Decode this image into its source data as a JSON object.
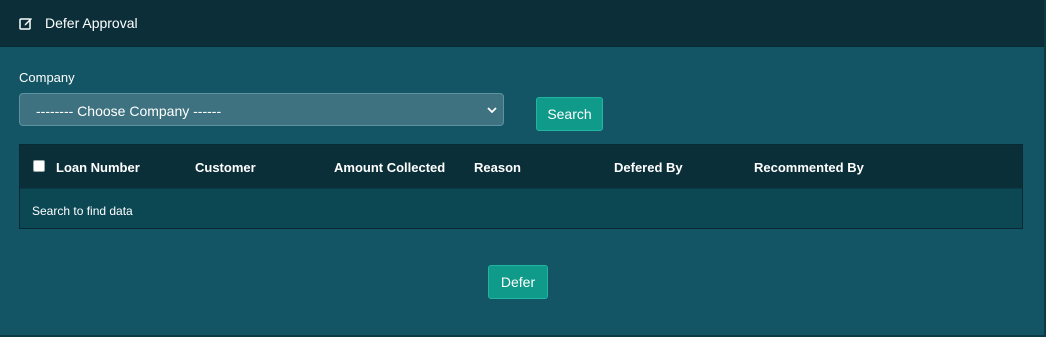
{
  "header": {
    "title": "Defer Approval",
    "icon": "edit-icon"
  },
  "form": {
    "company_label": "Company",
    "company_select_value": "-------- Choose Company ------",
    "search_button": "Search"
  },
  "table": {
    "columns": [
      "Loan Number",
      "Customer",
      "Amount Collected",
      "Reason",
      "Defered By",
      "Recommented By"
    ],
    "empty_message": "Search to find data"
  },
  "footer": {
    "defer_button": "Defer"
  },
  "colors": {
    "background": "#135565",
    "header_bg": "#0b2e38",
    "accent": "#0f9a8a"
  }
}
